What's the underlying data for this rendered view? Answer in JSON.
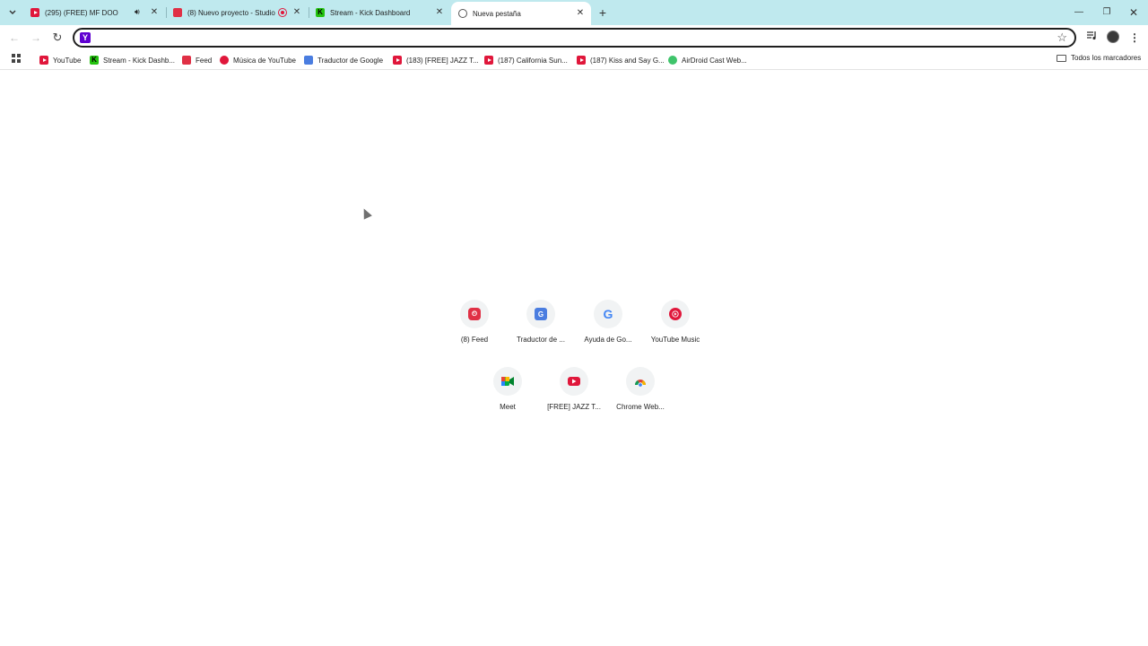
{
  "tabs": [
    {
      "title": "(295) (FREE) MF DOOM x Jo",
      "favicon": "youtube-icon",
      "has_audio": true,
      "active": false
    },
    {
      "title": "(8) Nuevo proyecto - Studio",
      "favicon": "feed-icon",
      "recording": true,
      "active": false
    },
    {
      "title": "Stream - Kick Dashboard",
      "favicon": "kick-icon",
      "active": false
    },
    {
      "title": "Nueva pestaña",
      "favicon": "globe-icon",
      "active": true
    }
  ],
  "toolbar": {
    "address_value": ""
  },
  "bookmarks": [
    {
      "label": "YouTube",
      "icon": "youtube-icon"
    },
    {
      "label": "Stream - Kick Dashb...",
      "icon": "kick-icon"
    },
    {
      "label": "Feed",
      "icon": "feed-icon"
    },
    {
      "label": "Música de YouTube",
      "icon": "youtube-music-icon"
    },
    {
      "label": "Traductor de Google",
      "icon": "google-translate-icon"
    },
    {
      "label": "(183) [FREE] JAZZ T...",
      "icon": "youtube-icon"
    },
    {
      "label": "(187) California Sun...",
      "icon": "youtube-icon"
    },
    {
      "label": "(187) Kiss and Say G...",
      "icon": "youtube-icon"
    },
    {
      "label": "AirDroid Cast Web...",
      "icon": "airdroid-icon"
    }
  ],
  "all_bookmarks_label": "Todos los marcadores",
  "shortcuts_row1": [
    {
      "label": "(8) Feed",
      "icon": "feed-icon"
    },
    {
      "label": "Traductor de ...",
      "icon": "google-translate-icon"
    },
    {
      "label": "Ayuda de Go...",
      "icon": "google-icon"
    },
    {
      "label": "YouTube Music",
      "icon": "youtube-music-icon"
    }
  ],
  "shortcuts_row2": [
    {
      "label": "Meet",
      "icon": "google-meet-icon"
    },
    {
      "label": "[FREE] JAZZ T...",
      "icon": "youtube-icon"
    },
    {
      "label": "Chrome Web...",
      "icon": "chrome-web-store-icon"
    }
  ]
}
